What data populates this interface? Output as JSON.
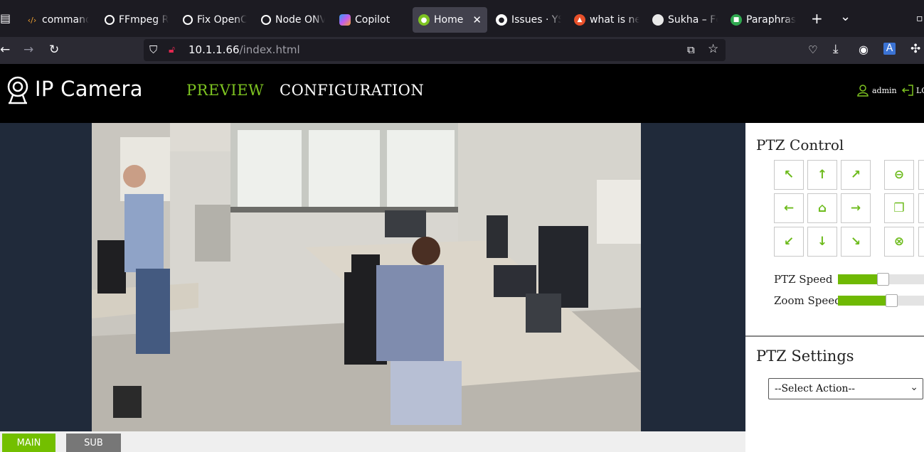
{
  "browser": {
    "tabs": [
      {
        "label": "command",
        "icon": "code-icon",
        "color": "#f0a030"
      },
      {
        "label": "FFmpeg R",
        "icon": "openai-icon",
        "color": "#ffffff"
      },
      {
        "label": "Fix OpenC",
        "icon": "openai-icon",
        "color": "#ffffff"
      },
      {
        "label": "Node ONV",
        "icon": "openai-icon",
        "color": "#ffffff"
      },
      {
        "label": "Copilot",
        "icon": "copilot-icon",
        "color": "#c05cf0"
      },
      {
        "label": "Home",
        "icon": "camera-user-icon",
        "color": "#7dc321",
        "active": true
      },
      {
        "label": "Issues · YS",
        "icon": "github-icon",
        "color": "#ffffff"
      },
      {
        "label": "what is ne",
        "icon": "brave-icon",
        "color": "#e8502a"
      },
      {
        "label": "Sukha – Fc",
        "icon": "circle-icon",
        "color": "#e9e9e9"
      },
      {
        "label": "Paraphras",
        "icon": "paraphrase-icon",
        "color": "#2fa84f"
      }
    ],
    "url_host": "10.1.1.66",
    "url_path": "/index.html",
    "new_tab": "+",
    "list_tabs": "⌄"
  },
  "app": {
    "brand": "IP Camera",
    "nav": {
      "preview": "PREVIEW",
      "configuration": "CONFIGURATION"
    },
    "user": "admin",
    "logout": "LO"
  },
  "stream": {
    "main": "MAIN",
    "sub": "SUB"
  },
  "ptz": {
    "title": "PTZ Control",
    "speed_label": "PTZ Speed",
    "zoom_label": "Zoom Speed",
    "ptz_speed": 0.52,
    "zoom_speed": 0.62,
    "buttons": [
      {
        "name": "up-left",
        "glyph": "↖"
      },
      {
        "name": "up",
        "glyph": "↑"
      },
      {
        "name": "up-right",
        "glyph": "↗"
      },
      {
        "name": "left",
        "glyph": "←"
      },
      {
        "name": "home",
        "glyph": "⌂"
      },
      {
        "name": "right",
        "glyph": "→"
      },
      {
        "name": "down-left",
        "glyph": "↙"
      },
      {
        "name": "down",
        "glyph": "↓"
      },
      {
        "name": "down-right",
        "glyph": "↘"
      },
      {
        "name": "zoom-out",
        "glyph": "⊖"
      },
      {
        "name": "focus",
        "glyph": "❐"
      },
      {
        "name": "stop",
        "glyph": "⊗"
      }
    ]
  },
  "settings": {
    "title": "PTZ Settings",
    "select_value": "--Select Action--"
  },
  "colors": {
    "accent": "#73bf00",
    "header_bg": "#000000",
    "video_bg": "#202a3a"
  }
}
